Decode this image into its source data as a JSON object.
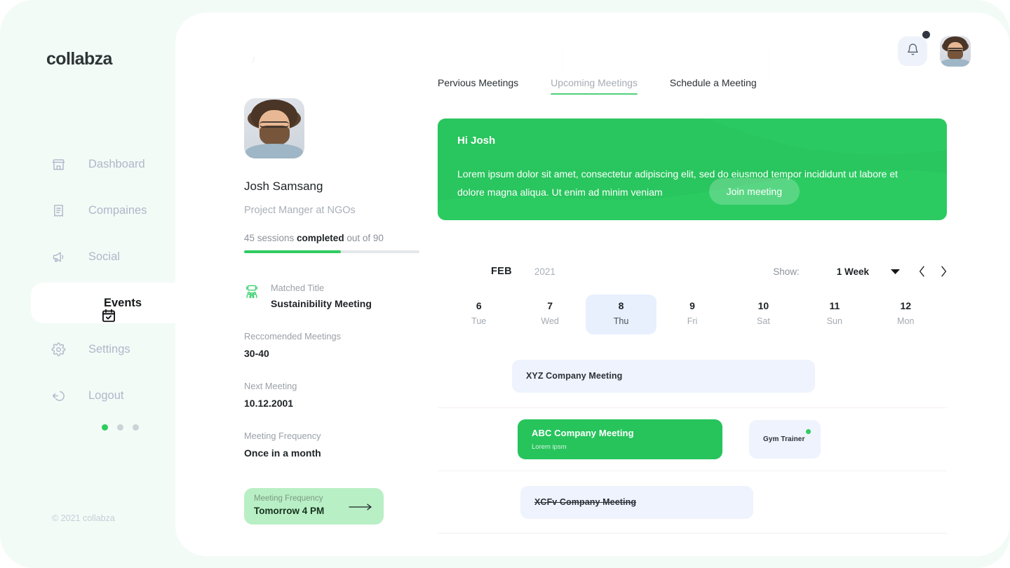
{
  "brand": {
    "logo": "collabza",
    "copyright": "© 2021 collabza",
    "accent_green": "#29c55e",
    "panel_mint": "#f3fbf7",
    "event_blue": "#eef3fd"
  },
  "sidebar": {
    "items": [
      {
        "label": "Dashboard",
        "icon": "store-icon",
        "active": false
      },
      {
        "label": "Compaines",
        "icon": "receipt-icon",
        "active": false
      },
      {
        "label": "Social",
        "icon": "megaphone-icon",
        "active": false
      },
      {
        "label": "Events",
        "icon": "calendar-check-icon",
        "active": true
      },
      {
        "label": "Settings",
        "icon": "gear-icon",
        "active": false
      },
      {
        "label": "Logout",
        "icon": "logout-icon",
        "active": false
      }
    ]
  },
  "topbar": {
    "bell_icon": "bell-icon",
    "has_notification": true,
    "avatar": "user-avatar"
  },
  "profile": {
    "photo": "profile-photo",
    "name": "Josh Samsang",
    "role": "Project Manger at NGOs",
    "sessions_prefix": "45 sessions ",
    "sessions_bold": "completed",
    "sessions_suffix": " out of 90",
    "sessions_done": 45,
    "sessions_total": 90,
    "progress_percent": 55,
    "matched": {
      "icon": "meeting-people-icon",
      "label": "Matched Title",
      "value": "Sustainibility Meeting"
    },
    "fields": [
      {
        "label": "Reccomended Meetings",
        "value": "30-40"
      },
      {
        "label": "Next Meeting",
        "value": "10.12.2001"
      },
      {
        "label": "Meeting Frequency",
        "value": "Once in a month"
      }
    ],
    "highlight_card": {
      "label": "Meeting Frequency",
      "value": "Tomorrow 4 PM",
      "arrow_icon": "arrow-right-icon"
    },
    "carousel": {
      "count": 3,
      "active_index": 0
    }
  },
  "tabs": [
    {
      "label": "Pervious Meetings",
      "active": false
    },
    {
      "label": "Upcoming Meetings",
      "active": true
    },
    {
      "label": "Schedule a Meeting",
      "active": false
    }
  ],
  "banner": {
    "greeting": "Hi Josh",
    "body": "Lorem ipsum dolor sit amet, consectetur adipiscing elit, sed do eiusmod tempor incididunt ut labore et dolore magna aliqua. Ut enim ad minim veniam",
    "button": "Join meeting"
  },
  "calendar": {
    "month": "FEB",
    "year": "2021",
    "show_label": "Show:",
    "range_value": "1 Week",
    "caret_icon": "chevron-down-icon",
    "prev_icon": "chevron-left-icon",
    "next_icon": "chevron-right-icon",
    "days": [
      {
        "num": "6",
        "name": "Tue",
        "selected": false
      },
      {
        "num": "7",
        "name": "Wed",
        "selected": false
      },
      {
        "num": "8",
        "name": "Thu",
        "selected": true
      },
      {
        "num": "9",
        "name": "Fri",
        "selected": false
      },
      {
        "num": "10",
        "name": "Sat",
        "selected": false
      },
      {
        "num": "11",
        "name": "Sun",
        "selected": false
      },
      {
        "num": "12",
        "name": "Mon",
        "selected": false
      }
    ],
    "rows": [
      {
        "events": [
          {
            "title": "XYZ  Company Meeting",
            "subtitle": "",
            "style": "blue",
            "strike": false,
            "dot": false
          }
        ]
      },
      {
        "events": [
          {
            "title": "ABC Company Meeting",
            "subtitle": "Lorem ipsm",
            "style": "green",
            "strike": false,
            "dot": false
          },
          {
            "title": "Gym Trainer",
            "subtitle": "",
            "style": "blue",
            "strike": false,
            "dot": true
          }
        ]
      },
      {
        "events": [
          {
            "title": "XCFv Company Meeting",
            "subtitle": "",
            "style": "blue",
            "strike": true,
            "dot": false
          }
        ]
      }
    ]
  }
}
